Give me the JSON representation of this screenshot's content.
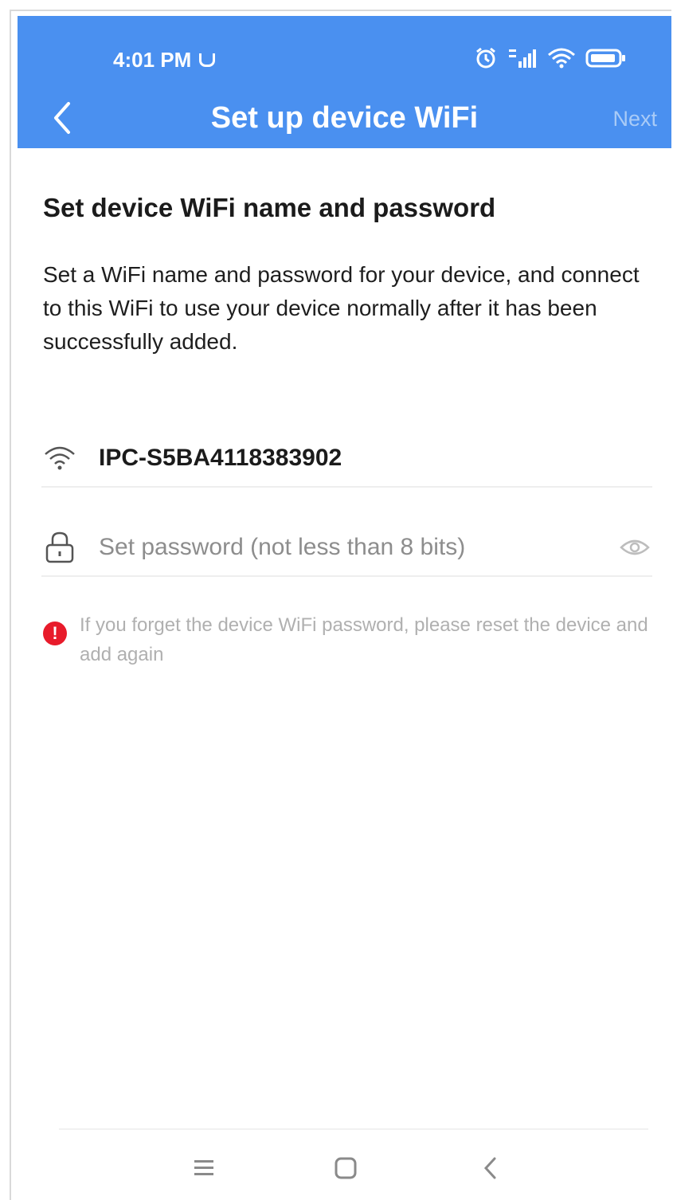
{
  "status_bar": {
    "time": "4:01 PM",
    "icons": [
      "alarm-icon",
      "signal-icon",
      "wifi-icon",
      "battery-icon"
    ]
  },
  "header": {
    "title": "Set up device WiFi",
    "next_label": "Next",
    "back_icon": "chevron-left-icon"
  },
  "content": {
    "section_title": "Set device WiFi name and password",
    "description": "Set a WiFi name and password for your device, and connect to this WiFi to use your device normally after it has been successfully added.",
    "wifi_name": "IPC-S5BA4118383902",
    "password_placeholder": "Set password (not less than 8 bits)",
    "password_value": "",
    "tip": "If you forget the device WiFi password, please reset the device and add again"
  },
  "nav_bar": {
    "buttons": [
      "menu-icon",
      "home-icon",
      "back-icon"
    ]
  },
  "colors": {
    "header_bg": "#4a90f0",
    "warning": "#e81b2b",
    "next_disabled": "#a9cbf7"
  }
}
